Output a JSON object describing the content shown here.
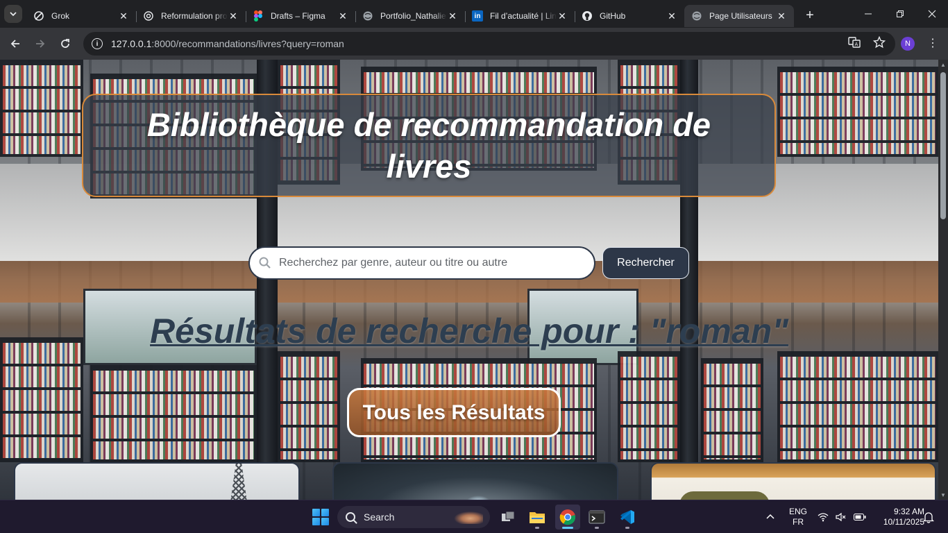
{
  "browser": {
    "tabs": [
      {
        "title": "Grok",
        "favicon": "grok-icon",
        "active": false
      },
      {
        "title": "Reformulation pro",
        "favicon": "openai-icon",
        "active": false
      },
      {
        "title": "Drafts – Figma",
        "favicon": "figma-icon",
        "active": false
      },
      {
        "title": "Portfolio_Nathalie",
        "favicon": "globe-icon",
        "active": false
      },
      {
        "title": "Fil d’actualité | LinkedIn",
        "favicon": "linkedin-icon",
        "active": false
      },
      {
        "title": "GitHub",
        "favicon": "github-icon",
        "active": false
      },
      {
        "title": "Page Utilisateurs",
        "favicon": "globe-icon",
        "active": true
      }
    ],
    "url_host": "127.0.0.1",
    "url_path": ":8000/recommandations/livres?query=roman",
    "profile_initial": "N"
  },
  "page": {
    "header_title": "Bibliothèque de recommandation de livres",
    "search": {
      "placeholder": "Recherchez par genre, auteur ou titre ou autre",
      "value": "",
      "button_label": "Rechercher"
    },
    "results_heading": "Résultats de recherche pour : \"roman\"",
    "all_results_label": "Tous les Résultats",
    "result_cards": [
      {
        "image": "eiffel-tower-cover"
      },
      {
        "image": "night-sky-cover"
      },
      {
        "image": "open-book-cover"
      }
    ]
  },
  "taskbar": {
    "search_label": "Search",
    "apps": [
      "task-view-icon",
      "file-explorer-icon",
      "chrome-icon",
      "terminal-icon",
      "vscode-icon"
    ],
    "active_app": "chrome-icon",
    "language_top": "ENG",
    "language_bottom": "FR",
    "time": "9:32 AM",
    "date": "10/11/2025"
  },
  "colors": {
    "header_border": "#d98a3a",
    "search_button_bg": "#2d3748",
    "results_heading": "#2d3e50",
    "all_results_bg": "#b86e35",
    "chrome_dark": "#202124",
    "chrome_toolbar": "#35363a",
    "taskbar_bg": "#1f1a2e"
  }
}
